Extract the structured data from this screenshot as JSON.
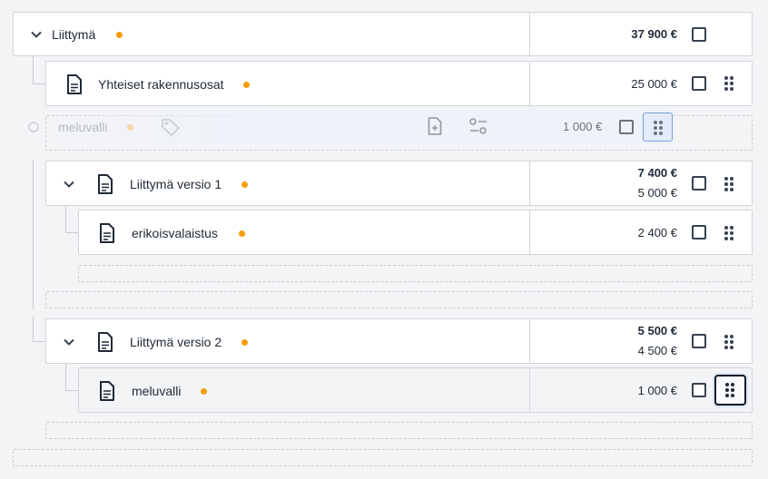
{
  "root": {
    "label": "Liittymä",
    "total": "37 900 €",
    "status_color": "#f59e0b"
  },
  "items": [
    {
      "label": "Yhteiset rakennusosat",
      "price": "25 000 €"
    },
    {
      "label": "Liittymä versio 1",
      "total": "7 400 €",
      "own": "5 000 €"
    },
    {
      "label": "erikoisvalaistus",
      "price": "2 400 €"
    },
    {
      "label": "Liittymä versio 2",
      "total": "5 500 €",
      "own": "4 500 €"
    },
    {
      "label": "meluvalli",
      "price": "1 000 €"
    }
  ],
  "drag_ghost": {
    "label": "meluvalli",
    "price": "1 000 €"
  },
  "icons": {
    "expand": "chevron-down-icon",
    "document": "document-icon",
    "tag": "tag-icon",
    "add_document": "add-document-icon",
    "adjust": "adjust-icon",
    "drag": "drag-handle-icon"
  }
}
